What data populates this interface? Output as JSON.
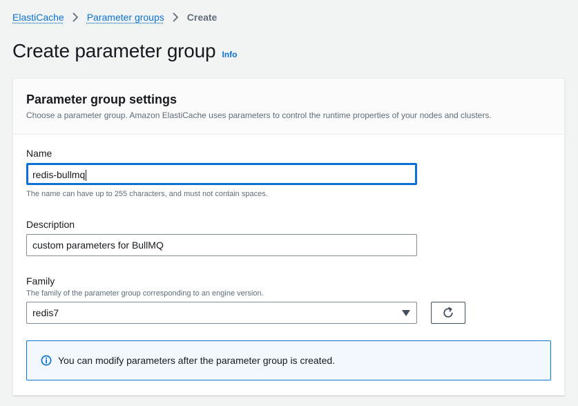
{
  "breadcrumb": {
    "items": [
      {
        "label": "ElastiCache"
      },
      {
        "label": "Parameter groups"
      }
    ],
    "current": "Create"
  },
  "page": {
    "title": "Create parameter group",
    "info_label": "Info"
  },
  "settings": {
    "title": "Parameter group settings",
    "description": "Choose a parameter group. Amazon ElastiCache uses parameters to control the runtime properties of your nodes and clusters.",
    "name": {
      "label": "Name",
      "value": "redis-bullmq",
      "hint": "The name can have up to 255 characters, and must not contain spaces."
    },
    "description_field": {
      "label": "Description",
      "value": "custom parameters for BullMQ"
    },
    "family": {
      "label": "Family",
      "hint": "The family of the parameter group corresponding to an engine version.",
      "selected": "redis7"
    },
    "alert": {
      "text": "You can modify parameters after the parameter group is created."
    }
  },
  "colors": {
    "link": "#0972d3",
    "focus": "#0972d3",
    "text": "#16191f",
    "muted": "#5f6b7a",
    "background": "#f2f3f3",
    "alert_bg": "#f2f8fd"
  },
  "icons": [
    "chevron-right-icon",
    "refresh-icon",
    "info-circle-icon",
    "caret-down-icon"
  ]
}
